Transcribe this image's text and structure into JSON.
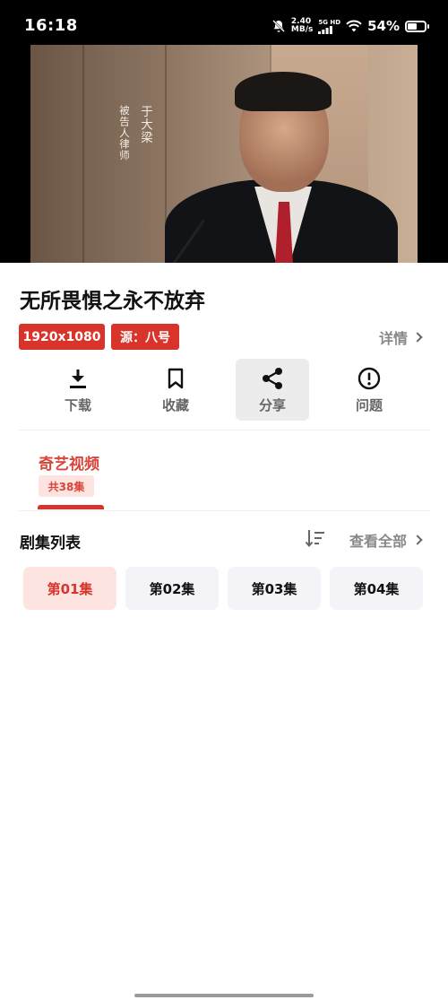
{
  "status_bar": {
    "time": "16:18",
    "net_speed_value": "2.40",
    "net_speed_unit": "MB/s",
    "network_top": "5G HD",
    "battery_percent": "54%",
    "battery_level": 0.54
  },
  "video": {
    "caption_name": "于大梁",
    "caption_role": "被告人律师"
  },
  "title": "无所畏惧之永不放弃",
  "tags": {
    "resolution": "1920x1080",
    "source": "源：八号"
  },
  "details_label": "详情",
  "actions": [
    {
      "label": "下载",
      "icon": "download-icon"
    },
    {
      "label": "收藏",
      "icon": "bookmark-icon"
    },
    {
      "label": "分享",
      "icon": "share-icon"
    },
    {
      "label": "问题",
      "icon": "alert-icon"
    }
  ],
  "source_tab": {
    "name": "奇艺视频",
    "count": "共38集"
  },
  "episode_list": {
    "title": "剧集列表",
    "view_all": "查看全部",
    "episodes": [
      "第01集",
      "第02集",
      "第03集",
      "第04集"
    ],
    "selected_index": 0
  },
  "colors": {
    "accent": "#d9342b",
    "accent_soft": "#fde4e1",
    "chip_bg": "#f4f4f8"
  }
}
